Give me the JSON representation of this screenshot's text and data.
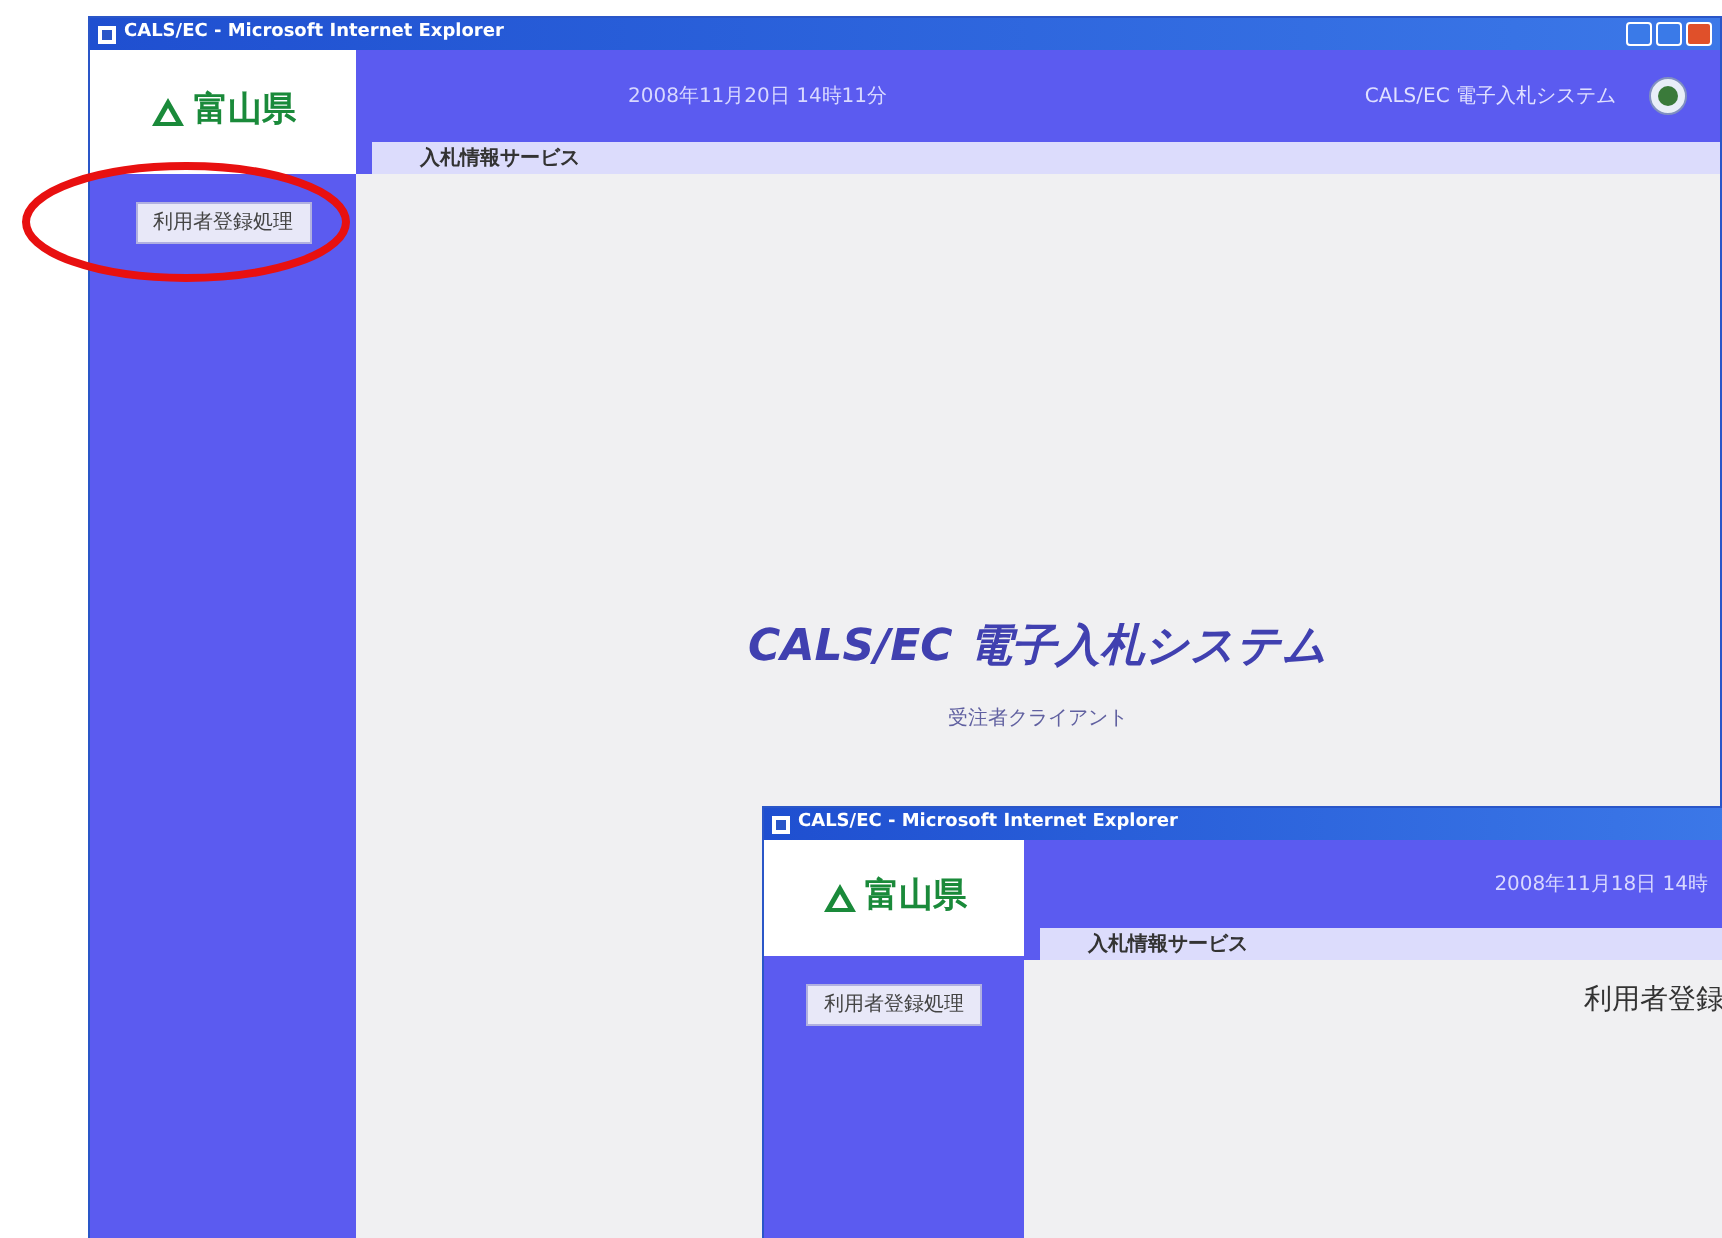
{
  "windows": [
    {
      "title": "CALS/EC - Microsoft Internet Explorer",
      "logo": "富山県",
      "datetime": "2008年11月20日 14時11分",
      "system_name": "CALS/EC 電子入札システム",
      "section": "入札情報サービス",
      "sidebar_buttons": [
        "利用者登録処理"
      ],
      "main_title": "CALS/EC 電子入札システム",
      "main_subtitle": "受注者クライアント"
    },
    {
      "title": "CALS/EC - Microsoft Internet Explorer",
      "logo": "富山県",
      "datetime": "2008年11月18日 14時",
      "section": "入札情報サービス",
      "sidebar_buttons": [
        "利用者登録処理"
      ],
      "heading": "利用者登録"
    }
  ]
}
